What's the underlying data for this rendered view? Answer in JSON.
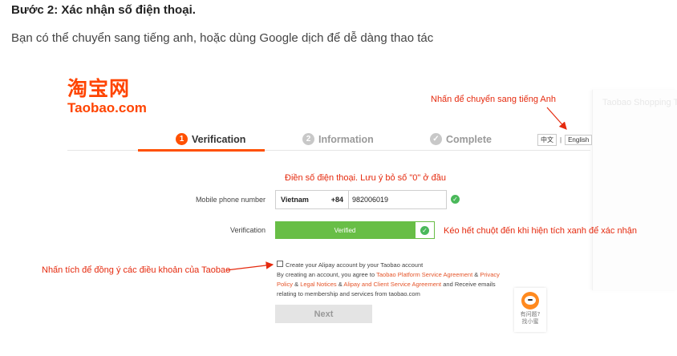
{
  "article": {
    "heading": "Bước 2: Xác nhận số điện thoại.",
    "intro": "Bạn có thể chuyển sang tiếng anh, hoặc dùng Google dịch để dễ dàng thao tác"
  },
  "side_panel": {
    "text": "Taobao Shopping Tool"
  },
  "logo": {
    "cn": "淘宝网",
    "en": "Taobao.com"
  },
  "annotations": {
    "switch_english": "Nhấn để chuyển sang tiếng Anh",
    "phone_hint": "Điền số điện thoại. Lưu ý bỏ số \"0\" ở đầu",
    "slide_hint": "Kéo hết chuột đến khi hiện tích xanh để xác nhận",
    "agree_hint": "Nhấn tích để đồng ý các điều khoản của Taobao"
  },
  "steps": [
    {
      "num": "1",
      "label": "Verification",
      "state": "active"
    },
    {
      "num": "2",
      "label": "Information",
      "state": "inactive"
    },
    {
      "num": "✓",
      "label": "Complete",
      "state": "inactive"
    }
  ],
  "language": {
    "chinese": "中文",
    "separator": "|",
    "english": "English"
  },
  "form": {
    "phone_label": "Mobile phone number",
    "country": "Vietnam",
    "country_code": "+84",
    "phone_value": "982006019",
    "verification_label": "Verification",
    "verified_text": "Verified"
  },
  "agreement": {
    "line1": "Create your Alipay account by your Taobao account",
    "line2_prefix": "By creating an account, you agree to ",
    "link_tpsa": "Taobao Platform Service Agreement",
    "amp1": " & ",
    "link_privacy": "Privacy Policy",
    "amp2": " & ",
    "link_legal": "Legal Notices",
    "amp3": " & ",
    "link_alipay": "Alipay and Client Service Agreement",
    "suffix": " and Receive emails relating to membership and services from taobao.com"
  },
  "next_button": "Next",
  "helper": {
    "line1": "有问题?",
    "line2": "找小蜜"
  },
  "colors": {
    "brand": "#ff4400",
    "annotation": "#e52a0e",
    "verified": "#68be46"
  }
}
